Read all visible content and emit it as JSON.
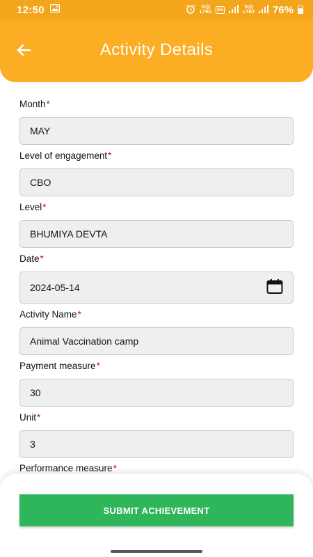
{
  "status_bar": {
    "time": "12:50",
    "net1": "Vo))",
    "net1_sub": "LTE1",
    "badge_5g": "5G",
    "net2": "Vo))",
    "net2_sub": "LTE2",
    "battery": "76%"
  },
  "header": {
    "title": "Activity Details",
    "color": "#fbad23"
  },
  "form": {
    "required_mark": "*",
    "fields": [
      {
        "label": "Month",
        "value": "MAY"
      },
      {
        "label": "Level of engagement",
        "value": "CBO"
      },
      {
        "label": "Level",
        "value": "BHUMIYA DEVTA"
      },
      {
        "label": "Date",
        "value": "2024-05-14"
      },
      {
        "label": "Activity Name",
        "value": "Animal Vaccination camp"
      },
      {
        "label": "Payment measure",
        "value": "30"
      },
      {
        "label": "Unit",
        "value": "3"
      },
      {
        "label": "Performance measure",
        "value": ""
      }
    ]
  },
  "submit": {
    "label": "SUBMIT ACHIEVEMENT",
    "color": "#2fb55a"
  }
}
